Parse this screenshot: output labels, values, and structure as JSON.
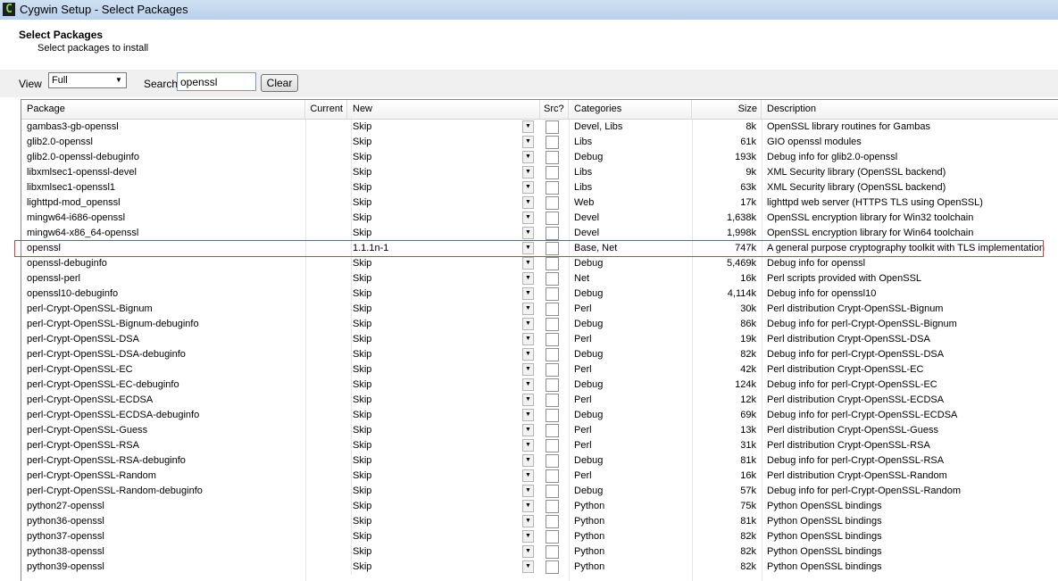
{
  "window": {
    "title": "Cygwin Setup - Select Packages",
    "icon": "cygwin-icon",
    "icon_glyph": "C"
  },
  "header": {
    "title": "Select Packages",
    "subtitle": "Select packages to install"
  },
  "toolbar": {
    "view_label": "View",
    "view_value": "Full",
    "search_label": "Search",
    "search_value": "openssl",
    "clear_label": "Clear"
  },
  "columns": {
    "package": "Package",
    "current": "Current",
    "new": "New",
    "src": "Src?",
    "categories": "Categories",
    "size": "Size",
    "description": "Description"
  },
  "packages": [
    {
      "name": "gambas3-gb-openssl",
      "new": "Skip",
      "categories": "Devel, Libs",
      "size": "8k",
      "description": "OpenSSL library routines for Gambas"
    },
    {
      "name": "glib2.0-openssl",
      "new": "Skip",
      "categories": "Libs",
      "size": "61k",
      "description": "GIO openssl modules"
    },
    {
      "name": "glib2.0-openssl-debuginfo",
      "new": "Skip",
      "categories": "Debug",
      "size": "193k",
      "description": "Debug info for glib2.0-openssl"
    },
    {
      "name": "libxmlsec1-openssl-devel",
      "new": "Skip",
      "categories": "Libs",
      "size": "9k",
      "description": "XML Security library (OpenSSL backend)"
    },
    {
      "name": "libxmlsec1-openssl1",
      "new": "Skip",
      "categories": "Libs",
      "size": "63k",
      "description": "XML Security library (OpenSSL backend)"
    },
    {
      "name": "lighttpd-mod_openssl",
      "new": "Skip",
      "categories": "Web",
      "size": "17k",
      "description": "lighttpd web server (HTTPS TLS using OpenSSL)"
    },
    {
      "name": "mingw64-i686-openssl",
      "new": "Skip",
      "categories": "Devel",
      "size": "1,638k",
      "description": "OpenSSL encryption library for Win32 toolchain"
    },
    {
      "name": "mingw64-x86_64-openssl",
      "new": "Skip",
      "categories": "Devel",
      "size": "1,998k",
      "description": "OpenSSL encryption library for Win64 toolchain"
    },
    {
      "name": "openssl",
      "new": "1.1.1n-1",
      "categories": "Base, Net",
      "size": "747k",
      "description": "A general purpose cryptography toolkit with TLS implementation"
    },
    {
      "name": "openssl-debuginfo",
      "new": "Skip",
      "categories": "Debug",
      "size": "5,469k",
      "description": "Debug info for openssl"
    },
    {
      "name": "openssl-perl",
      "new": "Skip",
      "categories": "Net",
      "size": "16k",
      "description": "Perl scripts provided with OpenSSL"
    },
    {
      "name": "openssl10-debuginfo",
      "new": "Skip",
      "categories": "Debug",
      "size": "4,114k",
      "description": "Debug info for openssl10"
    },
    {
      "name": "perl-Crypt-OpenSSL-Bignum",
      "new": "Skip",
      "categories": "Perl",
      "size": "30k",
      "description": "Perl distribution Crypt-OpenSSL-Bignum"
    },
    {
      "name": "perl-Crypt-OpenSSL-Bignum-debuginfo",
      "new": "Skip",
      "categories": "Debug",
      "size": "86k",
      "description": "Debug info for perl-Crypt-OpenSSL-Bignum"
    },
    {
      "name": "perl-Crypt-OpenSSL-DSA",
      "new": "Skip",
      "categories": "Perl",
      "size": "19k",
      "description": "Perl distribution Crypt-OpenSSL-DSA"
    },
    {
      "name": "perl-Crypt-OpenSSL-DSA-debuginfo",
      "new": "Skip",
      "categories": "Debug",
      "size": "82k",
      "description": "Debug info for perl-Crypt-OpenSSL-DSA"
    },
    {
      "name": "perl-Crypt-OpenSSL-EC",
      "new": "Skip",
      "categories": "Perl",
      "size": "42k",
      "description": "Perl distribution Crypt-OpenSSL-EC"
    },
    {
      "name": "perl-Crypt-OpenSSL-EC-debuginfo",
      "new": "Skip",
      "categories": "Debug",
      "size": "124k",
      "description": "Debug info for perl-Crypt-OpenSSL-EC"
    },
    {
      "name": "perl-Crypt-OpenSSL-ECDSA",
      "new": "Skip",
      "categories": "Perl",
      "size": "12k",
      "description": "Perl distribution Crypt-OpenSSL-ECDSA"
    },
    {
      "name": "perl-Crypt-OpenSSL-ECDSA-debuginfo",
      "new": "Skip",
      "categories": "Debug",
      "size": "69k",
      "description": "Debug info for perl-Crypt-OpenSSL-ECDSA"
    },
    {
      "name": "perl-Crypt-OpenSSL-Guess",
      "new": "Skip",
      "categories": "Perl",
      "size": "13k",
      "description": "Perl distribution Crypt-OpenSSL-Guess"
    },
    {
      "name": "perl-Crypt-OpenSSL-RSA",
      "new": "Skip",
      "categories": "Perl",
      "size": "31k",
      "description": "Perl distribution Crypt-OpenSSL-RSA"
    },
    {
      "name": "perl-Crypt-OpenSSL-RSA-debuginfo",
      "new": "Skip",
      "categories": "Debug",
      "size": "81k",
      "description": "Debug info for perl-Crypt-OpenSSL-RSA"
    },
    {
      "name": "perl-Crypt-OpenSSL-Random",
      "new": "Skip",
      "categories": "Perl",
      "size": "16k",
      "description": "Perl distribution Crypt-OpenSSL-Random"
    },
    {
      "name": "perl-Crypt-OpenSSL-Random-debuginfo",
      "new": "Skip",
      "categories": "Debug",
      "size": "57k",
      "description": "Debug info for perl-Crypt-OpenSSL-Random"
    },
    {
      "name": "python27-openssl",
      "new": "Skip",
      "categories": "Python",
      "size": "75k",
      "description": "Python OpenSSL bindings"
    },
    {
      "name": "python36-openssl",
      "new": "Skip",
      "categories": "Python",
      "size": "81k",
      "description": "Python OpenSSL bindings"
    },
    {
      "name": "python37-openssl",
      "new": "Skip",
      "categories": "Python",
      "size": "82k",
      "description": "Python OpenSSL bindings"
    },
    {
      "name": "python38-openssl",
      "new": "Skip",
      "categories": "Python",
      "size": "82k",
      "description": "Python OpenSSL bindings"
    },
    {
      "name": "python39-openssl",
      "new": "Skip",
      "categories": "Python",
      "size": "82k",
      "description": "Python OpenSSL bindings"
    }
  ],
  "highlighted_package": "openssl",
  "colors": {
    "highlight_border": "#c8444a",
    "titlebar": "#b9d1ec"
  }
}
